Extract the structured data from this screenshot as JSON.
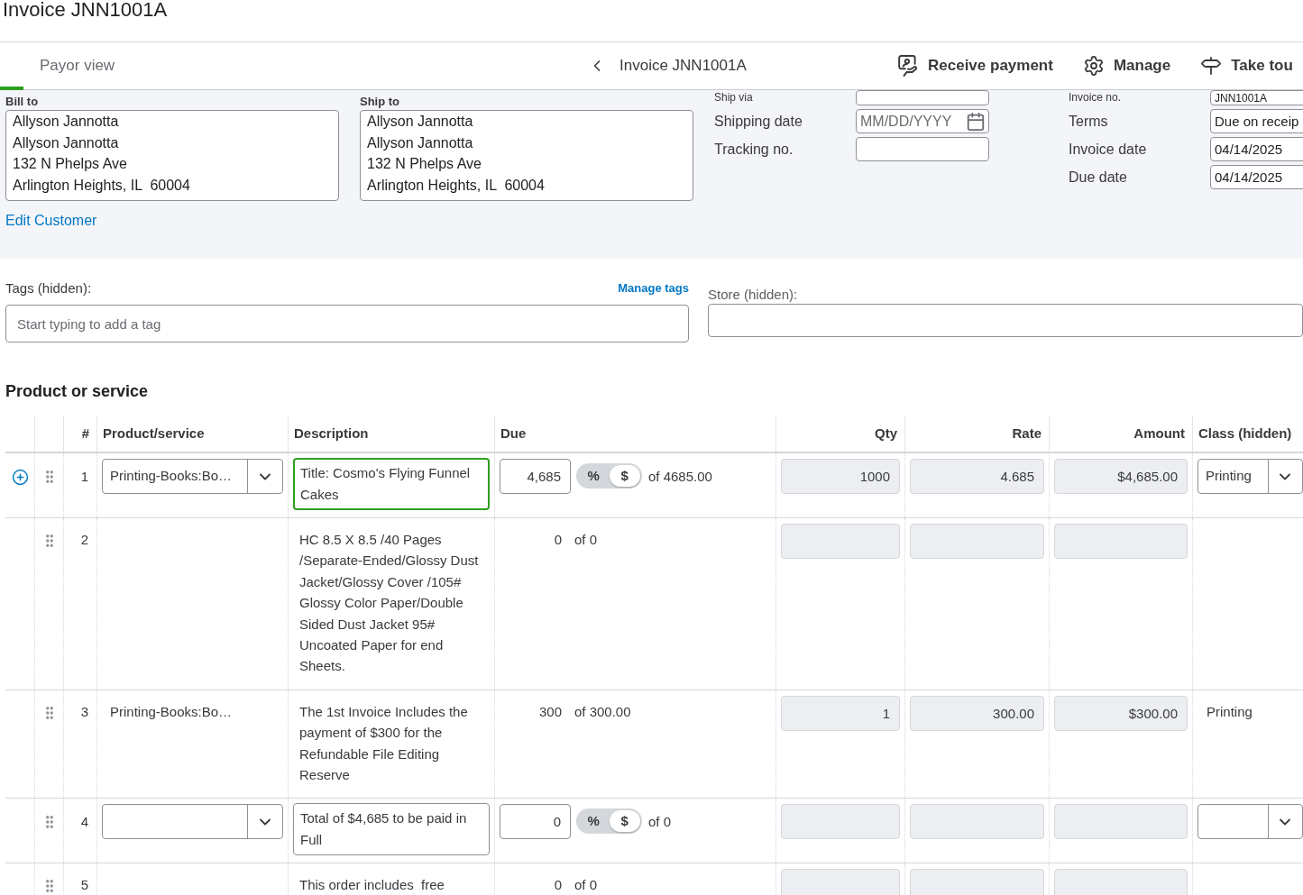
{
  "page_title": "Invoice JNN1001A",
  "header": {
    "view_tab": "Payor view",
    "title": "Invoice JNN1001A",
    "actions": [
      {
        "label": "Receive payment"
      },
      {
        "label": "Manage"
      },
      {
        "label": "Take tou"
      }
    ]
  },
  "bill_to": {
    "label": "Bill to",
    "lines": [
      "Allyson Jannotta",
      "Allyson Jannotta",
      "132 N Phelps Ave",
      "Arlington Heights, IL  60004"
    ]
  },
  "ship_to": {
    "label": "Ship to",
    "lines": [
      "Allyson Jannotta",
      "Allyson Jannotta",
      "132 N Phelps Ave",
      "Arlington Heights, IL  60004"
    ]
  },
  "edit_customer_link": "Edit Customer",
  "shipping_fields": [
    {
      "label": "Ship via",
      "kind": "text"
    },
    {
      "label": "Shipping date",
      "kind": "date",
      "placeholder": "MM/DD/YYYY"
    },
    {
      "label": "Tracking no.",
      "kind": "text"
    }
  ],
  "invoice_fields": [
    {
      "label": "Invoice no.",
      "value": "JNN1001A"
    },
    {
      "label": "Terms",
      "value": "Due on receip"
    },
    {
      "label": "Invoice date",
      "value": "04/14/2025"
    },
    {
      "label": "Due date",
      "value": "04/14/2025"
    }
  ],
  "tags": {
    "label": "Tags (hidden):",
    "manage_link": "Manage tags",
    "placeholder": "Start typing to add a tag"
  },
  "store": {
    "label": "Store (hidden):"
  },
  "products": {
    "title": "Product or service",
    "columns": [
      "#",
      "Product/service",
      "Description",
      "Due",
      "Qty",
      "Rate",
      "Amount",
      "Class (hidden)"
    ],
    "rows": [
      {
        "kind": "edit",
        "active": true,
        "number": "1",
        "product": "Printing-Books:Bo…",
        "description": "Title: Cosmo's Flying Funnel Cakes",
        "due": "4,685",
        "toggle": [
          {
            "label": "%",
            "selected": false
          },
          {
            "label": "$",
            "selected": true
          }
        ],
        "due_of": "of 4685.00",
        "qty": "1000",
        "rate": "4.685",
        "amount": "$4,685.00",
        "class": "Printing"
      },
      {
        "kind": "display",
        "active": false,
        "number": "2",
        "description": "HC 8.5 X 8.5 /40 Pages /Separate-Ended/Glossy Dust Jacket/Glossy Cover /105#  Glossy Color Paper/Double Sided Dust Jacket 95# Uncoated Paper for end Sheets.",
        "due": "0",
        "due_of": "of 0"
      },
      {
        "kind": "display",
        "active": false,
        "number": "3",
        "product": "Printing-Books:Bo…",
        "description": "The 1st Invoice Includes the payment of $300 for the Refundable File Editing Reserve",
        "due": "300",
        "due_of": "of 300.00",
        "qty": "1",
        "rate": "300.00",
        "amount": "$300.00",
        "class": "Printing"
      },
      {
        "kind": "edit",
        "active": false,
        "number": "4",
        "description": "Total of $4,685 to be paid in Full",
        "due": "0",
        "toggle": [
          {
            "label": "%",
            "selected": false
          },
          {
            "label": "$",
            "selected": true
          }
        ],
        "due_of": "of 0"
      },
      {
        "kind": "display",
        "active": false,
        "number": "5",
        "description": "This order includes  free",
        "due": "0",
        "due_of": "of 0"
      }
    ]
  }
}
